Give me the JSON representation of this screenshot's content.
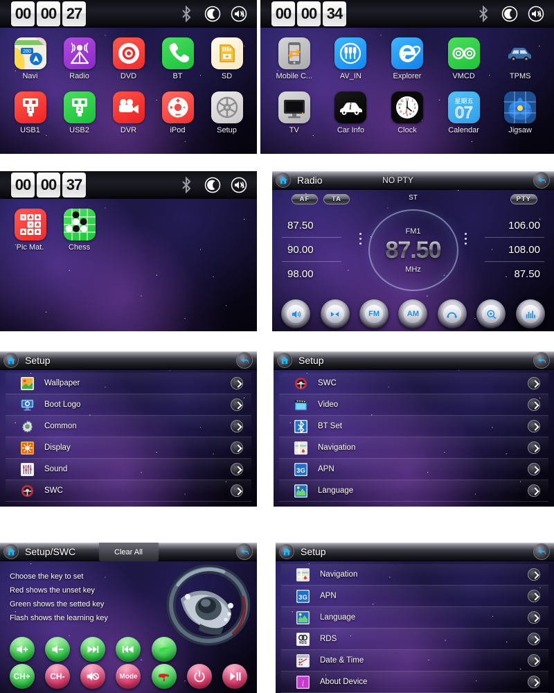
{
  "panels": {
    "home1": {
      "name": "Home screen page 1",
      "status": {
        "hh": "00",
        "mm": "00",
        "ss": "27",
        "icons": [
          "bluetooth-icon",
          "night-mode-icon",
          "mute-icon"
        ]
      },
      "apps_row1": [
        {
          "label": "Navi",
          "icon": "map-icon"
        },
        {
          "label": "Radio",
          "icon": "radio-broadcast-icon"
        },
        {
          "label": "DVD",
          "icon": "disc-icon"
        },
        {
          "label": "BT",
          "icon": "phone-icon"
        },
        {
          "label": "SD",
          "icon": "sd-card-icon"
        }
      ],
      "apps_row2": [
        {
          "label": "USB1",
          "icon": "usb-1-icon"
        },
        {
          "label": "USB2",
          "icon": "usb-2-icon"
        },
        {
          "label": "DVR",
          "icon": "video-camera-icon"
        },
        {
          "label": "iPod",
          "icon": "ipod-wheel-icon"
        },
        {
          "label": "Setup",
          "icon": "gear-icon"
        }
      ]
    },
    "home2": {
      "name": "Home screen page 2",
      "status": {
        "hh": "00",
        "mm": "00",
        "ss": "34",
        "icons": [
          "bluetooth-icon",
          "night-mode-icon",
          "mute-icon"
        ]
      },
      "apps_row1": [
        {
          "label": "Mobile C...",
          "icon": "phone-mirror-icon"
        },
        {
          "label": "AV_IN",
          "icon": "av-plugs-icon"
        },
        {
          "label": "Explorer",
          "icon": "internet-explorer-icon"
        },
        {
          "label": "VMCD",
          "icon": "tape-reels-icon"
        },
        {
          "label": "TPMS",
          "icon": "car-icon"
        }
      ],
      "apps_row2": [
        {
          "label": "TV",
          "icon": "television-icon"
        },
        {
          "label": "Car Info",
          "icon": "car-info-icon"
        },
        {
          "label": "Clock",
          "icon": "analog-clock-icon"
        },
        {
          "label": "Calendar",
          "icon": "calendar-icon",
          "weekday": "星期五",
          "day": "07"
        },
        {
          "label": "Jigsaw",
          "icon": "flower-puzzle-icon"
        }
      ]
    },
    "home3": {
      "name": "Home screen page 3",
      "status": {
        "hh": "00",
        "mm": "00",
        "ss": "37",
        "icons": [
          "bluetooth-icon",
          "night-mode-icon",
          "mute-icon"
        ]
      },
      "apps_row1": [
        {
          "label": "Pic Mat.",
          "icon": "picture-match-icon"
        },
        {
          "label": "Chess",
          "icon": "chess-board-icon"
        }
      ]
    },
    "radio": {
      "title": "Radio",
      "pty_status": "NO PTY",
      "home_icon": "home-icon",
      "back_icon": "back-arrow-icon",
      "buttons": {
        "af": "AF",
        "ta": "TA",
        "pty": "PTY"
      },
      "stereo_label": "ST",
      "band": "FM1",
      "frequency": "87.50",
      "unit": "MHz",
      "presets_left": [
        "87.50",
        "90.00",
        "98.00"
      ],
      "presets_right": [
        "106.00",
        "108.00",
        "87.50"
      ],
      "toolbar": [
        {
          "label": "",
          "icon": "speaker-icon"
        },
        {
          "label": "",
          "icon": "scan-seek-icon"
        },
        {
          "label": "FM",
          "icon": "fm-band-icon"
        },
        {
          "label": "AM",
          "icon": "am-band-icon"
        },
        {
          "label": "",
          "icon": "tune-arc-icon"
        },
        {
          "label": "",
          "icon": "auto-search-icon"
        },
        {
          "label": "",
          "icon": "equalizer-icon"
        }
      ]
    },
    "setup1": {
      "title": "Setup",
      "home_icon": "home-icon",
      "back_icon": "back-arrow-icon",
      "items": [
        {
          "label": "Wallpaper",
          "icon": "wallpaper-icon"
        },
        {
          "label": "Boot Logo",
          "icon": "monitor-icon"
        },
        {
          "label": "Common",
          "icon": "gear-icon"
        },
        {
          "label": "Display",
          "icon": "brightness-icon"
        },
        {
          "label": "Sound",
          "icon": "equalizer-icon"
        },
        {
          "label": "SWC",
          "icon": "steering-wheel-icon"
        }
      ]
    },
    "setup2": {
      "title": "Setup",
      "home_icon": "home-icon",
      "back_icon": "back-arrow-icon",
      "items": [
        {
          "label": "SWC",
          "icon": "steering-wheel-icon"
        },
        {
          "label": "Video",
          "icon": "film-clapper-icon"
        },
        {
          "label": "BT Set",
          "icon": "bluetooth-icon"
        },
        {
          "label": "Navigation",
          "icon": "navigation-map-icon"
        },
        {
          "label": "APN",
          "icon": "3g-icon"
        },
        {
          "label": "Language",
          "icon": "globe-icon"
        }
      ]
    },
    "swc": {
      "title": "Setup/SWC",
      "clear_all": "Clear All",
      "home_icon": "home-icon",
      "back_icon": "back-arrow-icon",
      "hints": [
        "Choose the key to set",
        "Red shows the unset key",
        "Green shows the setted key",
        "Flash shows the learning key"
      ],
      "keys_row1": [
        {
          "label": "",
          "icon": "volume-up-icon",
          "state": "green"
        },
        {
          "label": "",
          "icon": "volume-down-icon",
          "state": "green"
        },
        {
          "label": "",
          "icon": "next-track-icon",
          "state": "green"
        },
        {
          "label": "",
          "icon": "prev-track-icon",
          "state": "green"
        },
        {
          "label": "",
          "icon": "call-answer-icon",
          "state": "green"
        }
      ],
      "keys_row2": [
        {
          "label": "CH+",
          "icon": "",
          "state": "green"
        },
        {
          "label": "CH-",
          "icon": "",
          "state": "red"
        },
        {
          "label": "",
          "icon": "mute-icon",
          "state": "red"
        },
        {
          "label": "Mode",
          "icon": "",
          "state": "red"
        },
        {
          "label": "",
          "icon": "call-end-icon",
          "state": "green"
        },
        {
          "label": "",
          "icon": "power-icon",
          "state": "red"
        },
        {
          "label": "",
          "icon": "play-pause-icon",
          "state": "red"
        }
      ],
      "wheel_icon": "steering-wheel-image"
    },
    "setup3": {
      "title": "Setup",
      "home_icon": "home-icon",
      "back_icon": "back-arrow-icon",
      "items": [
        {
          "label": "Navigation",
          "icon": "navigation-map-icon"
        },
        {
          "label": "APN",
          "icon": "3g-icon"
        },
        {
          "label": "Language",
          "icon": "globe-icon"
        },
        {
          "label": "RDS",
          "icon": "rds-icon"
        },
        {
          "label": "Date & Time",
          "icon": "date-time-icon"
        },
        {
          "label": "About Device",
          "icon": "info-icon"
        }
      ]
    }
  },
  "colors": {
    "accent_blue": "#1b8fe0",
    "green_key": "#23b63c",
    "red_key": "#cd2f5e",
    "header_dark": "#1b1b24"
  }
}
